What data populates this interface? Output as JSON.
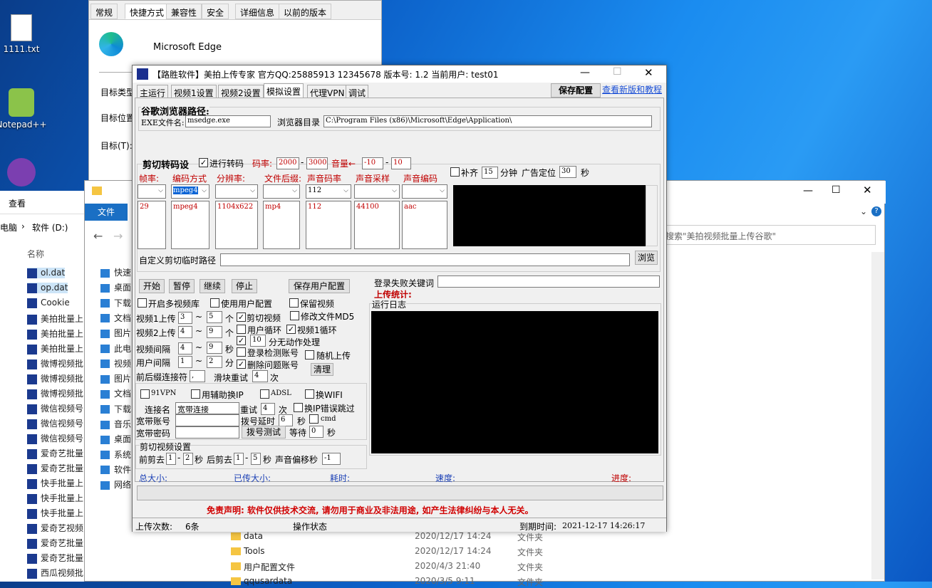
{
  "desktop": {
    "icons": [
      {
        "label": "1111.txt"
      },
      {
        "label": "Notepad++"
      }
    ]
  },
  "props_window": {
    "tabs": [
      "常规",
      "快捷方式",
      "兼容性",
      "安全",
      "详细信息",
      "以前的版本"
    ],
    "app_name": "Microsoft Edge",
    "labels": [
      "目标类型",
      "目标位置",
      "目标(T):"
    ]
  },
  "explorer": {
    "ribbon": [
      "查看"
    ],
    "file_tab": "文件",
    "path": [
      "电脑",
      "软件 (D:)"
    ],
    "search_placeholder": "搜索\"美拍视频批量上传谷歌\"",
    "nav": [
      "快速",
      "桌面",
      "下载",
      "文档",
      "图片",
      "此电",
      "视频",
      "图片",
      "文档",
      "下载",
      "音乐",
      "桌面",
      "系统",
      "软件",
      "网络"
    ],
    "left_header": "名称",
    "left_files": [
      "ol.dat",
      "op.dat",
      "Cookie",
      "美拍批量上",
      "美拍批量上",
      "美拍批量上",
      "微博视频批",
      "微博视频批",
      "微博视频批",
      "微信视频号",
      "微信视频号",
      "微信视频号",
      "爱奇艺批量",
      "爱奇艺批量",
      "快手批量上",
      "快手批量上",
      "快手批量上",
      "爱奇艺视频",
      "爱奇艺批量",
      "爱奇艺批量",
      "西瓜视频批"
    ],
    "right_files": [
      {
        "name": "data",
        "date": "2020/12/17 14:24",
        "type": "文件夹"
      },
      {
        "name": "Tools",
        "date": "2020/12/17 14:24",
        "type": "文件夹"
      },
      {
        "name": "用户配置文件",
        "date": "2020/4/3 21:40",
        "type": "文件夹"
      },
      {
        "name": "qqusardata",
        "date": "2020/3/5 9:11",
        "type": "文件夹"
      }
    ]
  },
  "app": {
    "title": "【路胜软件】美拍上传专家 官方QQ:25885913 12345678 版本号: 1.2 当前用户: test01",
    "tabs": [
      "主运行",
      "视频1设置",
      "视频2设置",
      "模拟设置",
      "代理VPN",
      "调试"
    ],
    "save_config": "保存配置",
    "update_link": "查看新版和教程",
    "browser": {
      "group_title": "谷歌浏览器路径:",
      "exe_label": "EXE文件名:",
      "exe_value": "msedge.exe",
      "dir_label": "浏览器目录",
      "dir_value": "C:\\Program Files (x86)\\Microsoft\\Edge\\Application\\"
    },
    "transcode": {
      "group_title": "剪切转码设",
      "enable_label": "进行转码",
      "bitrate_label": "码率:",
      "bitrate_min": "2000",
      "bitrate_max": "3000",
      "volume_label": "音量←",
      "volume_min": "-10",
      "volume_max": "10",
      "pad_label": "补齐",
      "pad_value": "15",
      "pad_unit": "分钟",
      "ad_label": "广告定位",
      "ad_value": "30",
      "ad_unit": "秒",
      "columns": [
        {
          "header": "帧率:",
          "selected": "",
          "value": "29"
        },
        {
          "header": "编码方式",
          "selected": "mpeg4",
          "value": "mpeg4"
        },
        {
          "header": "分辨率:",
          "selected": "",
          "value": "1104x622"
        },
        {
          "header": "文件后缀:",
          "selected": "",
          "value": "mp4"
        },
        {
          "header": "声音码率",
          "selected": "112",
          "value": "112"
        },
        {
          "header": "声音采样",
          "selected": "",
          "value": "44100"
        },
        {
          "header": "声音编码",
          "selected": "",
          "value": "aac"
        }
      ],
      "temp_path_label": "自定义剪切临时路径",
      "browse_button": "浏览"
    },
    "controls": {
      "start": "开始",
      "pause": "暂停",
      "resume": "继续",
      "stop": "停止",
      "save_user": "保存用户配置",
      "multi_lib": "开启多视频库",
      "use_user_cfg": "使用用户配置",
      "keep_video": "保留视频",
      "v1_upload": "视频1上传",
      "v1_min": "3",
      "v1_max": "5",
      "count_unit": "个",
      "cut_video": "剪切视频",
      "modify_md5": "修改文件MD5",
      "v2_upload": "视频2上传",
      "v2_min": "4",
      "v2_max": "9",
      "user_loop": "用户循环",
      "v1_loop": "视频1循环",
      "video_interval": "视频间隔",
      "vi_min": "4",
      "vi_max": "9",
      "sec_unit": "秒",
      "idle_value": "10",
      "idle_label": "分无动作处理",
      "user_interval": "用户间隔",
      "ui_min": "1",
      "ui_max": "2",
      "min_unit": "分",
      "login_check": "登录检测账号",
      "random_upload": "随机上传",
      "delete_problem": "删除问题账号",
      "clean": "清理",
      "connector_label": "前后缀连接符",
      "connector_value": ",",
      "retry_label": "滑块重试",
      "retry_value": "4",
      "retry_unit": "次",
      "tilde": "~"
    },
    "network": {
      "vpn91": "91VPN",
      "aux_ip": "用辅助换IP",
      "adsl": "ADSL",
      "wifi": "换WIFI",
      "conn_name_label": "连接名",
      "conn_name_value": "宽带连接",
      "conn_retry_label": "重试",
      "conn_retry_value": "4",
      "conn_retry_unit": "次",
      "ip_error_skip": "换IP错误跳过",
      "account_label": "宽带账号",
      "dial_delay_label": "拨号延时",
      "dial_delay_value": "6",
      "dial_delay_unit": "秒",
      "cmd": "cmd",
      "password_label": "宽带密码",
      "dial_test": "拨号测试",
      "wait_label": "等待",
      "wait_value": "0",
      "wait_unit": "秒"
    },
    "cut": {
      "group_title": "剪切视频设置",
      "front_label": "前剪去",
      "front_min": "1",
      "front_max": "2",
      "front_unit": "秒",
      "back_label": "后剪去",
      "back_min": "1",
      "back_max": "5",
      "back_unit": "秒",
      "audio_offset_label": "声音偏移秒",
      "audio_offset_value": "-1",
      "dash": "-"
    },
    "login": {
      "fail_keyword_label": "登录失败关键词",
      "upload_stats": "上传统计:",
      "log_label": "运行日志"
    },
    "status": {
      "total_size": "总大小:",
      "uploaded_size": "已传大小:",
      "elapsed": "耗时:",
      "speed": "速度:",
      "progress": "进度:",
      "progress_value": 0
    },
    "disclaimer": "免责声明: 软件仅供技术交流, 请勿用于商业及非法用途, 如产生法律纠纷与本人无关。",
    "statusbar": {
      "upload_count_label": "上传次数:",
      "upload_count_value": "6条",
      "op_status_label": "操作状态",
      "expire_label": "到期时间:",
      "expire_value": "2021-12-17 14:26:17"
    }
  }
}
